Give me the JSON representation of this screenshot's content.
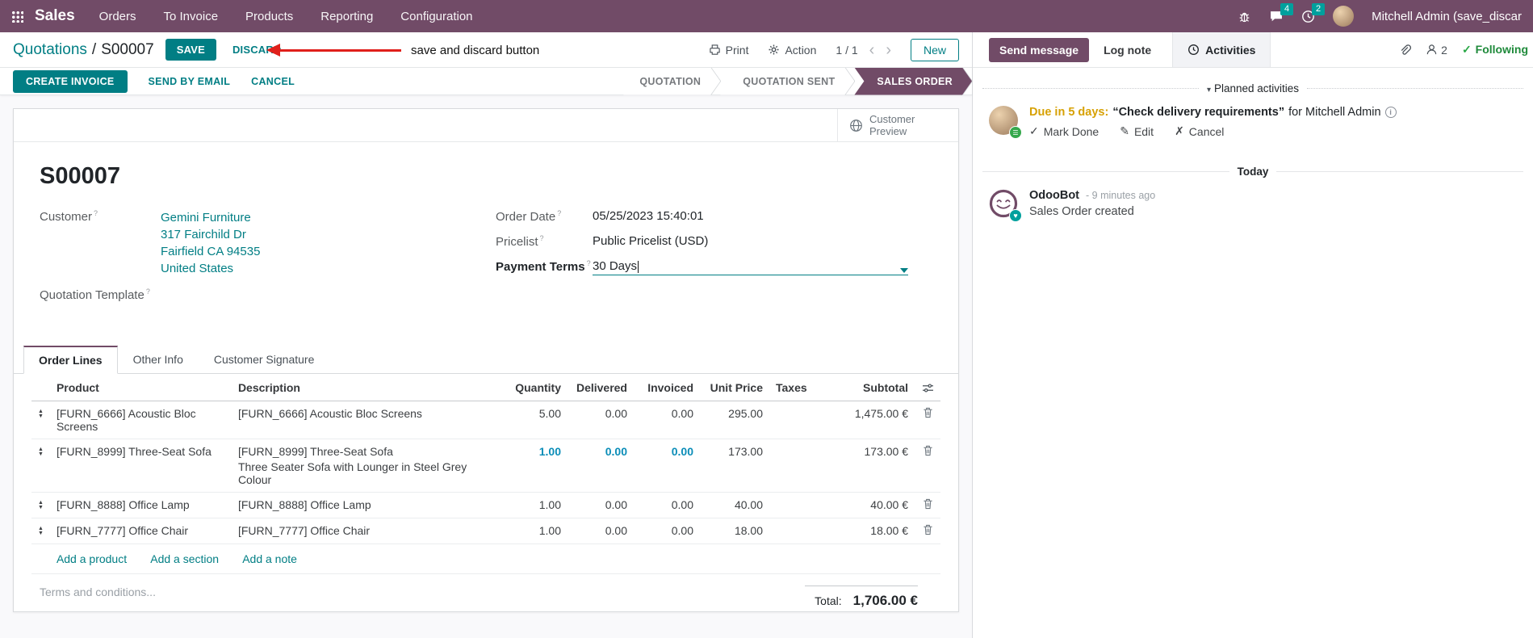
{
  "app": {
    "name": "Sales",
    "menus": [
      "Orders",
      "To Invoice",
      "Products",
      "Reporting",
      "Configuration"
    ],
    "systray": {
      "messages_count": "4",
      "activities_count": "2",
      "user": "Mitchell Admin (save_discar"
    }
  },
  "breadcrumb": {
    "path": "Quotations",
    "separator": "/",
    "record": "S00007",
    "save": "SAVE",
    "discard": "DISCARD"
  },
  "annotation": {
    "text": "save and discard button"
  },
  "control_panel": {
    "print": "Print",
    "action": "Action",
    "pager": "1 / 1",
    "prev": "‹",
    "next": "›",
    "new": "New"
  },
  "statusbar": {
    "buttons": [
      "CREATE INVOICE",
      "SEND BY EMAIL",
      "CANCEL"
    ],
    "states": [
      "QUOTATION",
      "QUOTATION SENT",
      "SALES ORDER"
    ],
    "active_state": "SALES ORDER"
  },
  "form": {
    "help_marker": "?",
    "preview_line1": "Customer",
    "preview_line2": "Preview",
    "name": "S00007",
    "fields": {
      "customer_label": "Customer",
      "customer_value": "Gemini Furniture",
      "address": [
        "317 Fairchild Dr",
        "Fairfield CA 94535",
        "United States"
      ],
      "quotation_template_label": "Quotation Template",
      "order_date_label": "Order Date",
      "order_date_value": "05/25/2023 15:40:01",
      "pricelist_label": "Pricelist",
      "pricelist_value": "Public Pricelist (USD)",
      "payment_terms_label": "Payment Terms",
      "payment_terms_value": "30 Days"
    },
    "tabs": [
      "Order Lines",
      "Other Info",
      "Customer Signature"
    ],
    "table": {
      "headers": [
        "Product",
        "Description",
        "Quantity",
        "Delivered",
        "Invoiced",
        "Unit Price",
        "Taxes",
        "Subtotal"
      ],
      "rows": [
        {
          "product": "[FURN_6666] Acoustic Bloc Screens",
          "description": "[FURN_6666] Acoustic Bloc Screens",
          "description2": "",
          "quantity": "5.00",
          "delivered": "0.00",
          "invoiced": "0.00",
          "unit_price": "295.00",
          "taxes": "",
          "subtotal": "1,475.00 €",
          "highlight": false
        },
        {
          "product": "[FURN_8999] Three-Seat Sofa",
          "description": "[FURN_8999] Three-Seat Sofa",
          "description2": "Three Seater Sofa with Lounger in Steel Grey Colour",
          "quantity": "1.00",
          "delivered": "0.00",
          "invoiced": "0.00",
          "unit_price": "173.00",
          "taxes": "",
          "subtotal": "173.00 €",
          "highlight": true
        },
        {
          "product": "[FURN_8888] Office Lamp",
          "description": "[FURN_8888] Office Lamp",
          "description2": "",
          "quantity": "1.00",
          "delivered": "0.00",
          "invoiced": "0.00",
          "unit_price": "40.00",
          "taxes": "",
          "subtotal": "40.00 €",
          "highlight": false
        },
        {
          "product": "[FURN_7777] Office Chair",
          "description": "[FURN_7777] Office Chair",
          "description2": "",
          "quantity": "1.00",
          "delivered": "0.00",
          "invoiced": "0.00",
          "unit_price": "18.00",
          "taxes": "",
          "subtotal": "18.00 €",
          "highlight": false
        }
      ],
      "footer_links": [
        "Add a product",
        "Add a section",
        "Add a note"
      ]
    },
    "terms_placeholder": "Terms and conditions...",
    "total_label": "Total:",
    "total_value": "1,706.00 €"
  },
  "chatter": {
    "send_message": "Send message",
    "log_note": "Log note",
    "activities": "Activities",
    "followers_count": "2",
    "following": "Following",
    "planned_activities_label": "Planned activities",
    "activity": {
      "due": "Due in 5 days:",
      "summary": "“Check delivery requirements”",
      "for_text": "for Mitchell Admin",
      "mark_done": "Mark Done",
      "edit": "Edit",
      "cancel": "Cancel"
    },
    "today_label": "Today",
    "message": {
      "author": "OdooBot",
      "time": "- 9 minutes ago",
      "body": "Sales Order created"
    }
  },
  "icons": {
    "check": "✓",
    "pencil": "✎",
    "cancel_x": "✗",
    "heart": "♥",
    "list": "☰",
    "planned_caret": "▾",
    "handle_up": "▲",
    "handle_down": "▼"
  },
  "colors": {
    "brand_purple": "#714B67",
    "primary_teal": "#017e84",
    "badge_teal": "#00A09D",
    "highlight_blue": "#0b8db8",
    "due_warning": "#d7a104",
    "following_green": "#1f8a3b",
    "annotation_red": "#e0201b"
  }
}
